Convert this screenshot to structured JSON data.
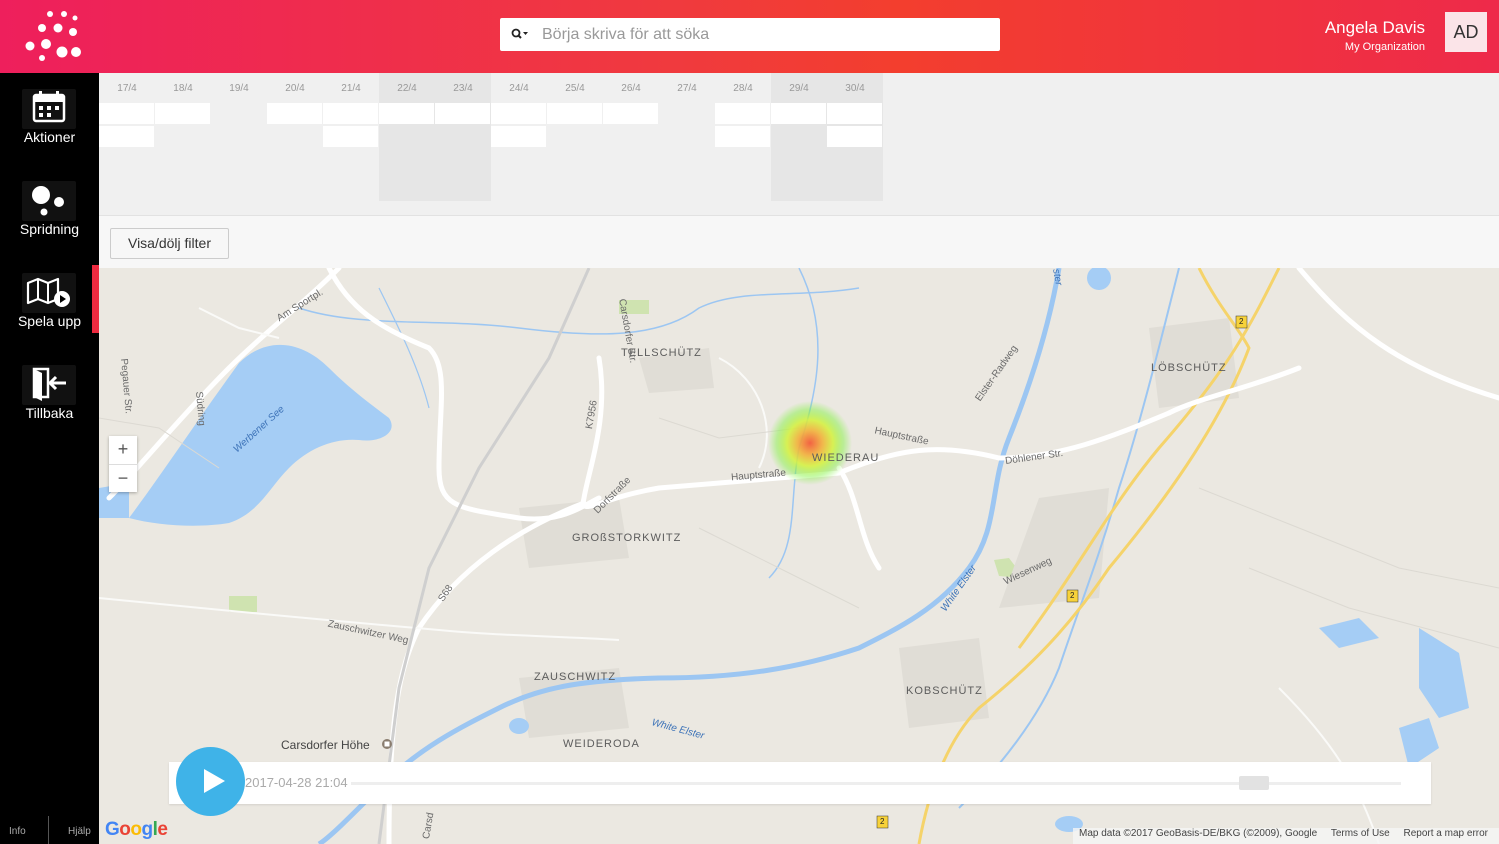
{
  "header": {
    "search_placeholder": "Börja skriva för att söka",
    "user_name": "Angela Davis",
    "user_org": "My Organization",
    "avatar_initials": "AD"
  },
  "sidebar": {
    "items": [
      {
        "label": "Aktioner",
        "icon": "calendar-icon"
      },
      {
        "label": "Spridning",
        "icon": "spread-dots-icon"
      },
      {
        "label": "Spela upp",
        "icon": "map-play-icon"
      },
      {
        "label": "Tillbaka",
        "icon": "exit-door-icon"
      }
    ],
    "active_item": "Spela upp",
    "footer": {
      "info": "Info",
      "help": "Hjälp"
    }
  },
  "timeline": {
    "dates": [
      "17/4",
      "18/4",
      "19/4",
      "20/4",
      "21/4",
      "22/4",
      "23/4",
      "24/4",
      "25/4",
      "26/4",
      "27/4",
      "28/4",
      "29/4",
      "30/4"
    ],
    "filled_rows_per_date": [
      2,
      1,
      0,
      1,
      2,
      1,
      1,
      2,
      1,
      1,
      0,
      2,
      1,
      2
    ],
    "shaded_dates": [
      "22/4",
      "23/4",
      "29/4",
      "30/4"
    ]
  },
  "filter_button": "Visa/dölj filter",
  "map": {
    "place_labels": [
      "TELLSCHÜTZ",
      "LÖBSCHÜTZ",
      "WIEDERAU",
      "GROßSTORKWITZ",
      "ZAUSCHWITZ",
      "KOBSCHÜTZ",
      "WEIDERODA",
      "Carsdorfer Höhe"
    ],
    "road_labels": [
      "Am Sportpl.",
      "Carsdorfer Str.",
      "Pegauer Str.",
      "Südring",
      "K7956",
      "Hauptstraße",
      "Hauptstraße",
      "Döhlener Str.",
      "Elster-Radweg",
      "Dorfstraße",
      "S68",
      "Zauschwitzer Weg",
      "Wiesenweg",
      "Carsd"
    ],
    "water_labels": [
      "Werbener See",
      "White Elster",
      "White Elster",
      "ster"
    ],
    "road_shields": [
      "2",
      "2",
      "2"
    ],
    "zoom_in": "+",
    "zoom_out": "−",
    "google_logo": "Google",
    "attribution": [
      "Map data ©2017 GeoBasis-DE/BKG (©2009), Google",
      "Terms of Use",
      "Report a map error"
    ]
  },
  "player": {
    "timestamp": "2017-04-28 21:04",
    "progress": 0.86
  },
  "colors": {
    "header_gradient_start": "#ee1f5c",
    "header_gradient_end": "#f33e2e",
    "sidebar_bg": "#000000",
    "active_indicator": "#ee2a3f",
    "play_button": "#3fb3e8",
    "map_land": "#ebe8e1",
    "map_water": "#a5cdf5"
  }
}
